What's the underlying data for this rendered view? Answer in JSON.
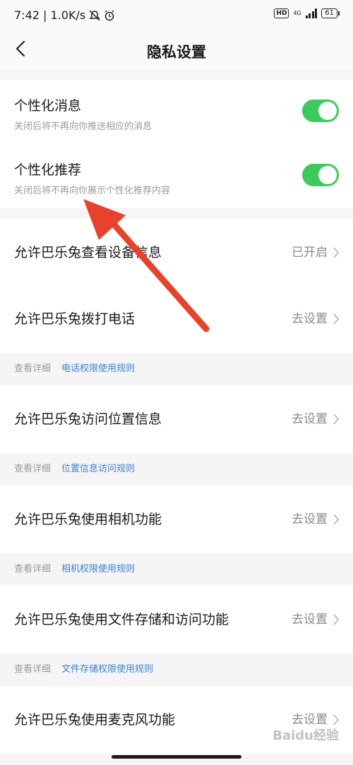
{
  "status_bar": {
    "time_speed": "7:42 | 1.0K/s",
    "hd": "HD",
    "network": "4G",
    "battery": "61"
  },
  "header": {
    "title": "隐私设置"
  },
  "toggles": [
    {
      "title": "个性化消息",
      "subtitle": "关闭后将不再向你推送相应的消息",
      "on": true
    },
    {
      "title": "个性化推荐",
      "subtitle": "关闭后将不再向你展示个性化推荐内容",
      "on": true
    }
  ],
  "rows": [
    {
      "label": "允许巴乐兔查看设备信息",
      "value": "已开启"
    },
    {
      "label": "允许巴乐兔拨打电话",
      "value": "去设置"
    },
    {
      "label": "允许巴乐兔访问位置信息",
      "value": "去设置"
    },
    {
      "label": "允许巴乐兔使用相机功能",
      "value": "去设置"
    },
    {
      "label": "允许巴乐兔使用文件存储和访问功能",
      "value": "去设置"
    },
    {
      "label": "允许巴乐兔使用麦克风功能",
      "value": "去设置"
    }
  ],
  "notes": [
    {
      "prefix": "查看详细",
      "link": "电话权限使用规则"
    },
    {
      "prefix": "查看详细",
      "link": "位置信息访问规则"
    },
    {
      "prefix": "查看详细",
      "link": "相机权限使用规则"
    },
    {
      "prefix": "查看详细",
      "link": "文件存储权限使用规则"
    }
  ],
  "watermark": "Baidu经验",
  "colors": {
    "switch_on": "#3ccb5a",
    "link": "#3d7fd6",
    "arrow": "#e8412c"
  }
}
